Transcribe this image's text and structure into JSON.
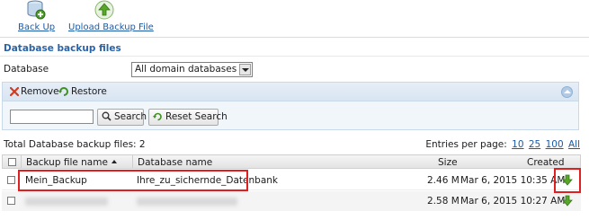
{
  "toolbar": {
    "backup_label": "Back Up",
    "upload_label": "Upload Backup File"
  },
  "section": {
    "title": "Database backup files"
  },
  "database_filter": {
    "label": "Database",
    "selected": "All domain databases"
  },
  "actions": {
    "remove_label": "Remove",
    "restore_label": "Restore"
  },
  "search": {
    "value": "",
    "search_label": "Search",
    "reset_label": "Reset Search"
  },
  "totals": {
    "text": "Total Database backup files: 2"
  },
  "paging": {
    "label": "Entries per page:",
    "options": [
      "10",
      "25",
      "100",
      "All"
    ]
  },
  "table": {
    "columns": {
      "file": "Backup file name",
      "database": "Database name",
      "size": "Size",
      "created": "Created"
    },
    "rows": [
      {
        "file": "Mein_Backup",
        "database": "Ihre_zu_sichernde_Datenbank",
        "size": "2.46 M",
        "created": "Mar 6, 2015 10:35 AM"
      },
      {
        "file": "",
        "database": "",
        "size": "2.58 M",
        "created": "Mar 6, 2015 10:27 AM"
      }
    ]
  },
  "colors": {
    "link": "#1a5aa8",
    "highlight": "#e02020",
    "download_green": "#5aa628"
  }
}
